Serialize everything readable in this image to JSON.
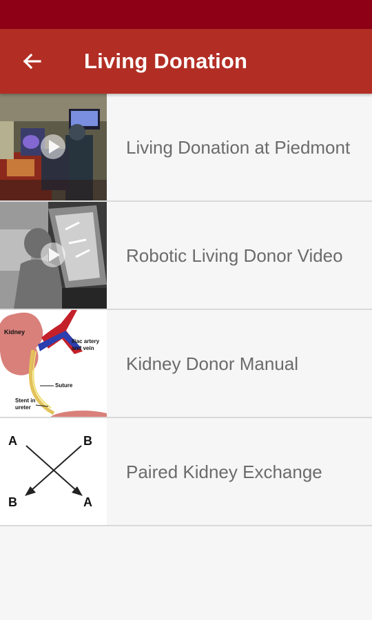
{
  "app_bar": {
    "title": "Living Donation",
    "back_icon": "arrow-left-icon"
  },
  "colors": {
    "status_bar": "#8e0015",
    "app_bar": "#b22e25",
    "background": "#f6f6f6",
    "item_text": "#6b6b6b",
    "divider": "#d9d9d9"
  },
  "items": [
    {
      "label": "Living Donation at Piedmont",
      "thumbnail": "surgery-video-thumbnail"
    },
    {
      "label": "Robotic Living Donor Video",
      "thumbnail": "robotic-surgery-video-thumbnail"
    },
    {
      "label": "Kidney Donor Manual",
      "thumbnail": "kidney-illustration"
    },
    {
      "label": "Paired Kidney Exchange",
      "thumbnail": "exchange-diagram"
    }
  ],
  "kidney_diagram_labels": {
    "kidney": "Kidney",
    "artery_line1": "Iliac artery",
    "artery_line2": "and vein",
    "suture": "Suture",
    "stent_line1": "Stent in",
    "stent_line2": "ureter"
  },
  "exchange_diagram_labels": {
    "top_left": "A",
    "top_right": "B",
    "bottom_left": "B",
    "bottom_right": "A"
  }
}
